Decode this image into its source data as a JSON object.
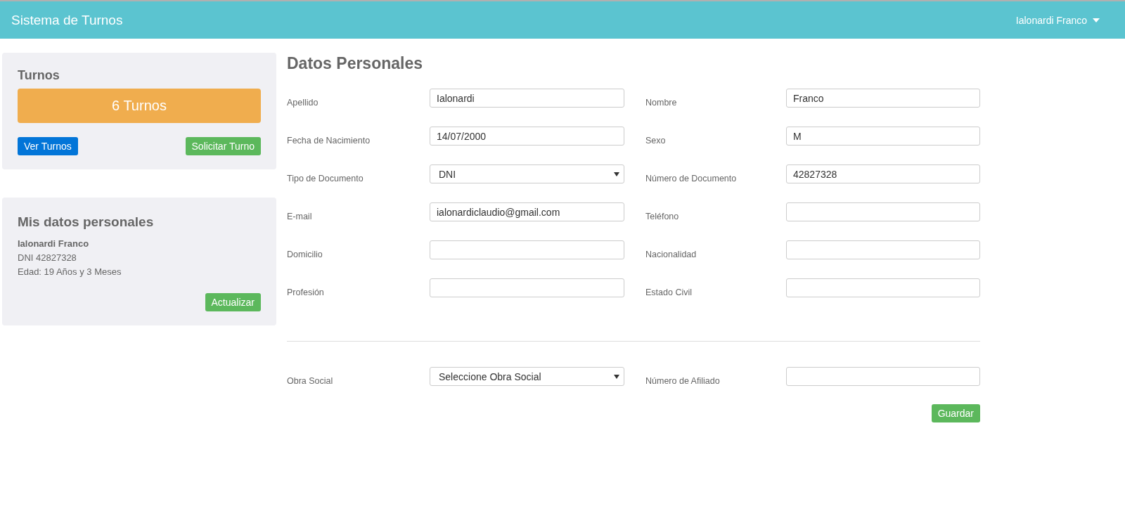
{
  "navbar": {
    "brand": "Sistema de Turnos",
    "user_menu": "Ialonardi Franco"
  },
  "turnos_card": {
    "title": "Turnos",
    "count": "6 Turnos",
    "buttons": [
      {
        "label": "Ver Turnos",
        "kind": "primary"
      },
      {
        "label": "Solicitar Turno",
        "kind": "success"
      }
    ]
  },
  "datos_card": {
    "title": "Mis datos personales",
    "name": "Ialonardi Franco",
    "document": "DNI 42827328",
    "age": "Edad: 19 Años y 3 Meses",
    "button": "Actualizar"
  },
  "form": {
    "title": "Datos Personales",
    "fields": [
      {
        "label": "Apellido",
        "kind": "text",
        "value": "Ialonardi"
      },
      {
        "label": "Nombre",
        "kind": "text",
        "value": "Franco"
      },
      {
        "label": "Fecha de Nacimiento",
        "kind": "text",
        "value": "14/07/2000"
      },
      {
        "label": "Sexo",
        "kind": "text",
        "value": "M"
      },
      {
        "label": "Tipo de Documento",
        "kind": "select",
        "value": "DNI"
      },
      {
        "label": "Número de Documento",
        "kind": "text",
        "value": "42827328"
      },
      {
        "label": "E-mail",
        "kind": "text",
        "value": "ialonardiclaudio@gmail.com"
      },
      {
        "label": "Teléfono",
        "kind": "text"
      },
      {
        "label": "Domicilio",
        "kind": "text"
      },
      {
        "label": "Nacionalidad",
        "kind": "text"
      },
      {
        "label": "Profesión",
        "kind": "text"
      },
      {
        "label": "Estado Civil",
        "kind": "text"
      }
    ],
    "insurance_fields": [
      {
        "label": "Obra Social",
        "kind": "select",
        "value": "Seleccione Obra Social"
      },
      {
        "label": "Número de Afiliado",
        "kind": "text"
      }
    ],
    "save_button": "Guardar"
  }
}
